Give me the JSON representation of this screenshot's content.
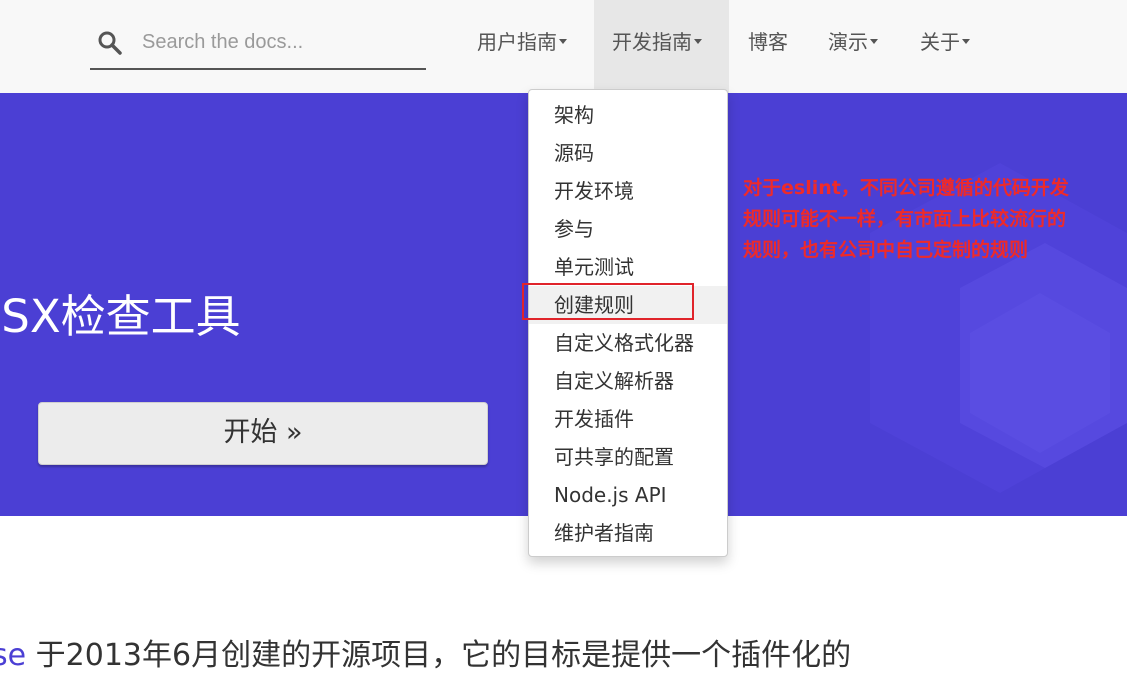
{
  "search": {
    "placeholder": "Search the docs..."
  },
  "nav": {
    "items": [
      {
        "label": "用户指南",
        "has_dropdown": true
      },
      {
        "label": "开发指南",
        "has_dropdown": true,
        "active": true
      },
      {
        "label": "博客",
        "has_dropdown": false
      },
      {
        "label": "演示",
        "has_dropdown": true
      },
      {
        "label": "关于",
        "has_dropdown": true
      }
    ]
  },
  "hero": {
    "title": "JSX检查工具",
    "start_button": "开始 »"
  },
  "dropdown": {
    "items": [
      "架构",
      "源码",
      "开发环境",
      "参与",
      "单元测试",
      "创建规则",
      "自定义格式化器",
      "自定义解析器",
      "开发插件",
      "可共享的配置",
      "Node.js API",
      "维护者指南"
    ],
    "hovered_item": "创建规则"
  },
  "annotation": {
    "lines": [
      "对于eslint，不同公司遵循的代码开发",
      "规则可能不一样，有市面上比较流行的",
      "规则，也有公司中自己定制的规则"
    ]
  },
  "body": {
    "link_fragment": "se",
    "text_fragment": "于2013年6月创建的开源项目，它的目标是提供一个插件化的"
  },
  "colors": {
    "hero_bg": "#4b3fd4",
    "annotation": "#ee2a2a",
    "highlight_border": "#e0242b",
    "navbar_bg": "#f8f8f8"
  }
}
